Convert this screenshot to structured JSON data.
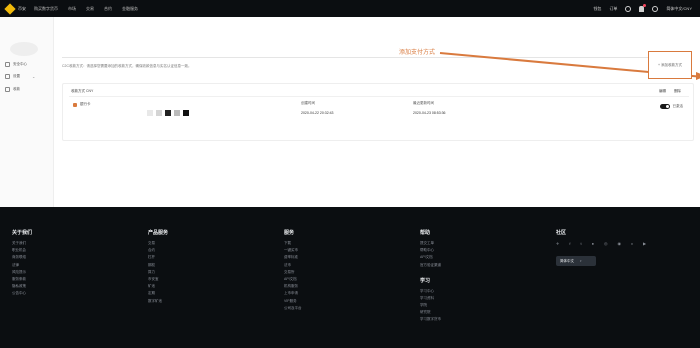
{
  "header": {
    "logo_text": "币安",
    "nav": [
      "购买数字货币",
      "市场",
      "交易",
      "合约",
      "金融服务"
    ],
    "right": [
      "钱包",
      "订单",
      "简体中文/CNY"
    ]
  },
  "sidebar": {
    "items": [
      {
        "label": "安全中心",
        "icon": "shield-icon"
      },
      {
        "label": "设置",
        "icon": "gear-icon"
      },
      {
        "label": "收款",
        "icon": "card-icon"
      }
    ]
  },
  "main": {
    "description": "C2C收款方式：请选择您需要添加的收款方式，确保收款信息与实名认证信息一致。",
    "annotation_label": "添加支付方式",
    "add_button_label": "+ 添加收款方式",
    "card": {
      "title": "收款方式 CNY",
      "actions": [
        "编辑",
        "删除"
      ],
      "bank_name": "银行卡",
      "created_label": "创建时间",
      "created_value": "2020-04-22 20:32:43",
      "updated_label": "最近更新时间",
      "updated_value": "2020-04-23 08:53:36",
      "toggle_label": "已激活"
    }
  },
  "footer": {
    "columns": [
      {
        "title": "关于我们",
        "links": [
          "关于我们",
          "职业机会",
          "商务联络",
          "法律",
          "风险提示",
          "服务条款",
          "隐私政策",
          "公告中心"
        ]
      },
      {
        "title": "产品服务",
        "links": [
          "交易",
          "合约",
          "杠杆",
          "期权",
          "算力",
          "币安宝",
          "矿池",
          "定期",
          "数字矿池"
        ]
      },
      {
        "title": "服务",
        "links": [
          "下载",
          "一键买币",
          "费率标准",
          "法币",
          "交易所",
          "API文档",
          "机构服务",
          "上币申请",
          "VIP服务",
          "公司及平台"
        ]
      },
      {
        "title": "帮助",
        "links": [
          "提交工单",
          "帮助中心",
          "API文档",
          "官方验证渠道"
        ]
      },
      {
        "title": "学习",
        "links": [
          "学习中心",
          "学习资料",
          "学院",
          "研究院",
          "学习数字货币"
        ]
      }
    ],
    "social_title": "社区",
    "social_icons": [
      "telegram-icon",
      "facebook-icon",
      "twitter-icon",
      "reddit-icon",
      "instagram-icon",
      "coinmarketcap-icon",
      "vk-icon",
      "youtube-icon"
    ],
    "language": "简体中文",
    "colors": {
      "accent": "#d97a3e",
      "brand": "#f0b90b",
      "bg": "#0b0e11"
    }
  }
}
